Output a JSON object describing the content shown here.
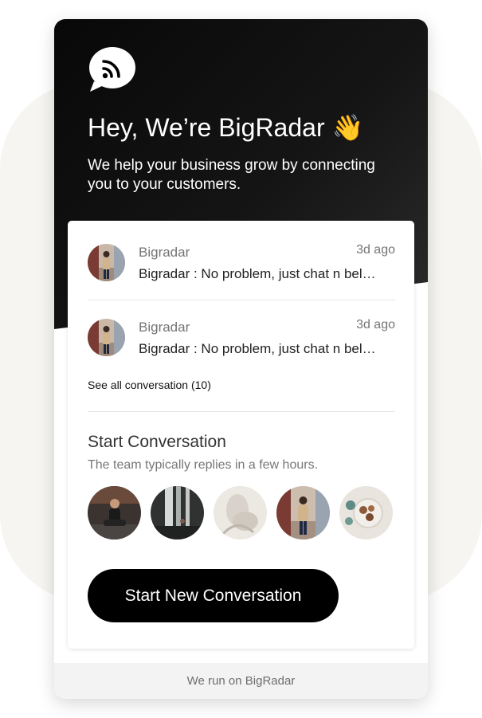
{
  "hero": {
    "title": "Hey, We’re BigRadar 👋",
    "subtitle": "We help your business grow by connecting you to your customers.",
    "logo_icon": "chat-rss-icon"
  },
  "conversations": [
    {
      "name": "Bigradar",
      "time": "3d ago",
      "message": "Bigradar : No problem, just chat n bel…"
    },
    {
      "name": "Bigradar",
      "time": "3d ago",
      "message": "Bigradar : No problem, just chat n bel…"
    }
  ],
  "see_all": "See all conversation (10)",
  "start": {
    "title": "Start Conversation",
    "subtitle": "The team typically replies in a few hours.",
    "button_label": "Start New Conversation"
  },
  "team_avatars": [
    "team-avatar-man",
    "team-avatar-waterfall",
    "team-avatar-statue",
    "team-avatar-woman",
    "team-avatar-food"
  ],
  "footer": "We run on BigRadar",
  "colors": {
    "hero_bg": "#0b0b0b",
    "accent": "#000000",
    "page_bg": "#f7f5f1"
  }
}
